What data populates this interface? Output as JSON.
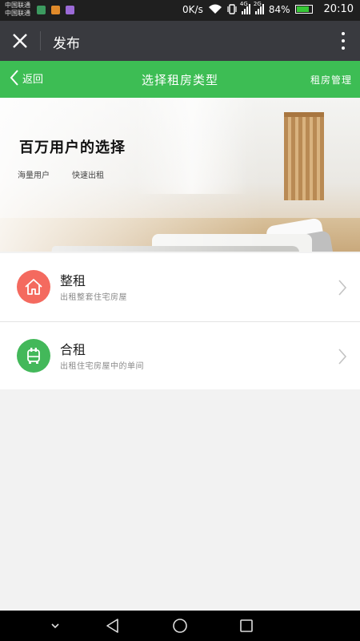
{
  "status_bar": {
    "carrier_1": "中国联通",
    "carrier_2": "中国联通",
    "speed": "0K/s",
    "net_1": "4G",
    "net_2": "2G",
    "battery": "84%",
    "battery_level": 0.84,
    "time": "20:10",
    "app_icon_colors": [
      "#3c9a5f",
      "#e08a2a",
      "#9b6ad6"
    ]
  },
  "topnav": {
    "title": "发布",
    "close_icon": "close-icon",
    "more_icon": "more-vertical-icon"
  },
  "header": {
    "back_label": "返回",
    "title": "选择租房类型",
    "manage_label": "租房管理",
    "color": "#3dbd54"
  },
  "banner": {
    "title": "百万用户的选择",
    "tags": [
      "海量用户",
      "快速出租"
    ]
  },
  "options": [
    {
      "title": "整租",
      "desc": "出租整套住宅房屋",
      "icon": "house-icon",
      "color": "#f46a5f"
    },
    {
      "title": "合租",
      "desc": "出租住宅房屋中的单间",
      "icon": "room-icon",
      "color": "#43b85a"
    }
  ]
}
